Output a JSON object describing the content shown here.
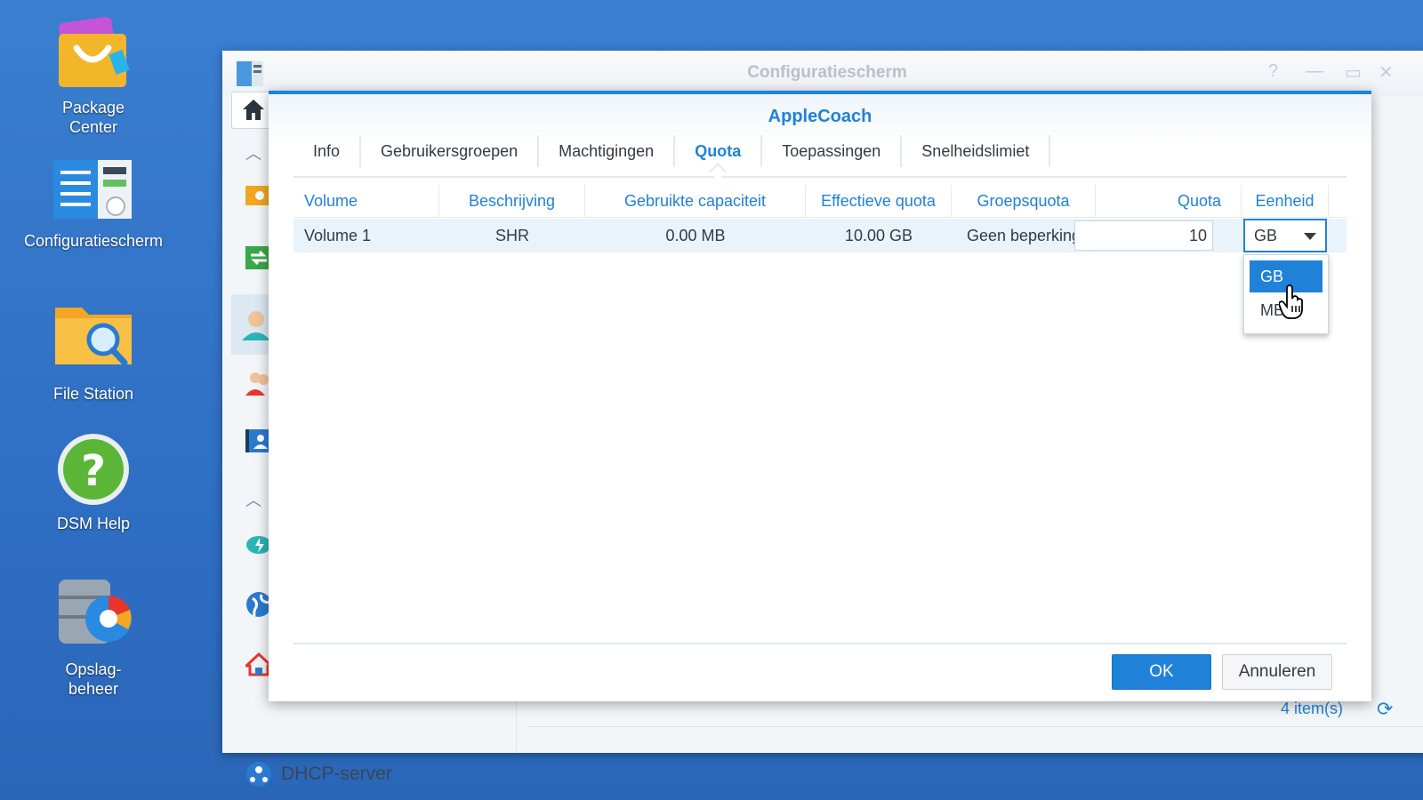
{
  "desktop": {
    "icons": [
      {
        "label": "Package\nCenter",
        "icon": "package-center-icon"
      },
      {
        "label": "Configuratiescherm",
        "icon": "control-panel-icon"
      },
      {
        "label": "File Station",
        "icon": "file-station-icon"
      },
      {
        "label": "DSM Help",
        "icon": "dsm-help-icon"
      },
      {
        "label": "Opslag-\nbeheer",
        "icon": "storage-manager-icon"
      }
    ]
  },
  "window": {
    "title": "Configuratiescherm",
    "controls": [
      "?",
      "—",
      "▭",
      "✕"
    ],
    "sidebar": {
      "dhcp_label": "DHCP-server"
    },
    "items_count": "4 item(s)"
  },
  "dialog": {
    "title": "AppleCoach",
    "tabs": [
      "Info",
      "Gebruikersgroepen",
      "Machtigingen",
      "Quota",
      "Toepassingen",
      "Snelheidslimiet"
    ],
    "active_tab": "Quota",
    "columns": [
      "Volume",
      "Beschrijving",
      "Gebruikte capaciteit",
      "Effectieve quota",
      "Groepsquota",
      "Quota",
      "Eenheid"
    ],
    "rows": [
      {
        "volume": "Volume 1",
        "description": "SHR",
        "used": "0.00 MB",
        "effective": "10.00 GB",
        "group_quota": "Geen beperking",
        "quota": "10",
        "unit": "GB"
      }
    ],
    "unit_options": [
      "GB",
      "MB"
    ],
    "ok_label": "OK",
    "cancel_label": "Annuleren"
  },
  "colors": {
    "accent": "#1f82d8",
    "desktop_bg": "#2f6fc4"
  }
}
